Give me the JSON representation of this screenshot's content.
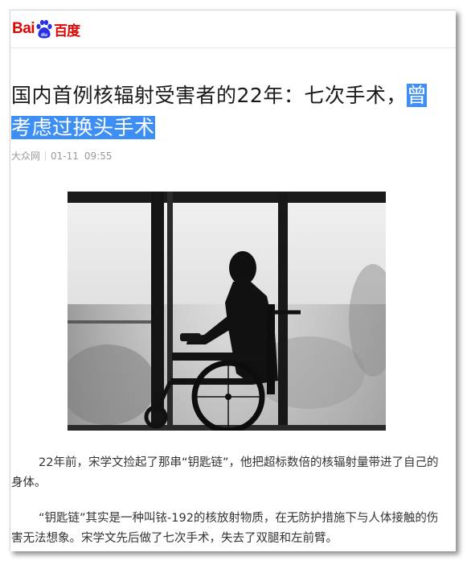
{
  "header": {
    "logo_latin": "Bai",
    "logo_du": "du",
    "logo_chinese": "百度",
    "brand_color": "#e10602"
  },
  "article": {
    "title_main": "国内首例核辐射受害者的22年：七次手术，",
    "title_highlight": "曾考虑过换头手术",
    "highlight_color": "#3d8ef5",
    "source": "大众网",
    "date": "01-11",
    "time": "09:55",
    "image_alt": "wheelchair silhouette photo",
    "paragraphs": [
      "22年前，宋学文捡起了那串“钥匙链”，他把超标数倍的核辐射量带进了自己的身体。",
      "“钥匙链”其实是一种叫铱-192的核放射物质，在无防护措施下与人体接触的伤害无法想象。宋学文先后做了七次手术，失去了双腿和左前臂。"
    ]
  }
}
